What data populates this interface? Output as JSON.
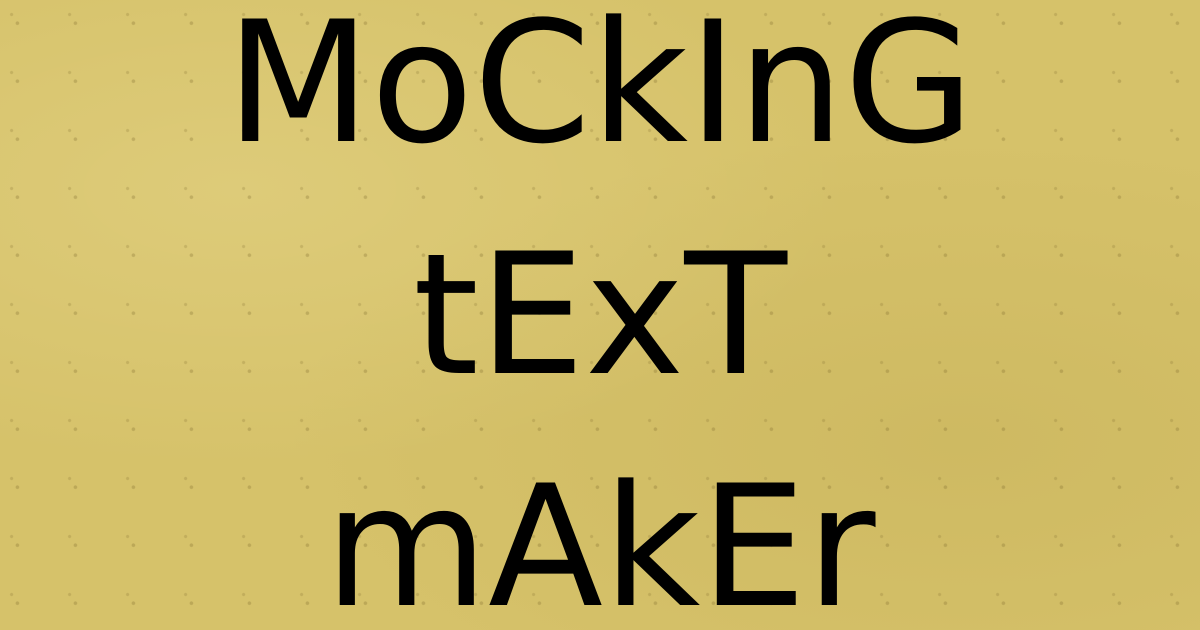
{
  "title": {
    "lines": [
      "MoCkInG",
      "tExT",
      "mAkEr"
    ]
  },
  "colors": {
    "background": "#d6c26a",
    "text": "#000000"
  }
}
